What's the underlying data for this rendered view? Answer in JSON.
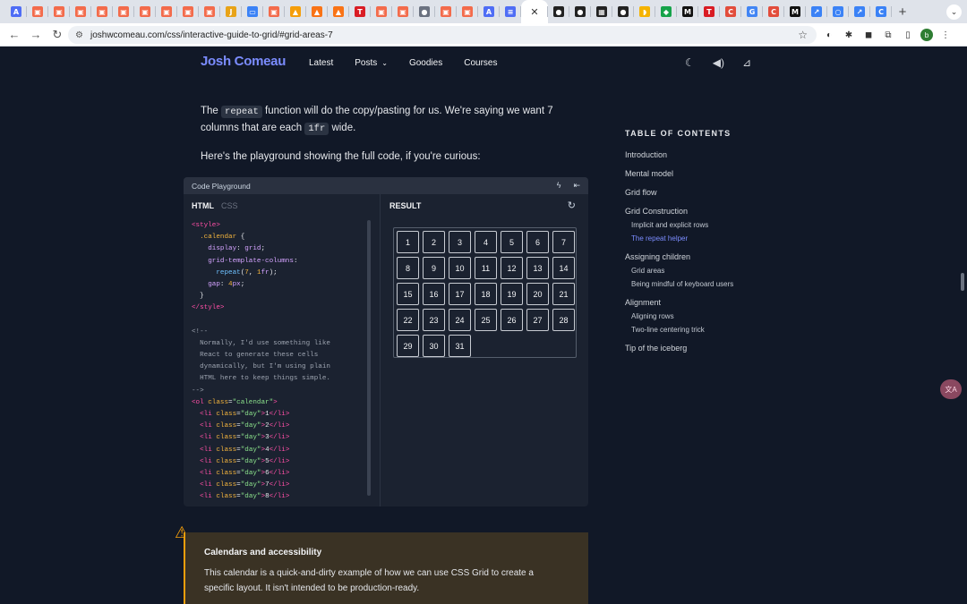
{
  "browser": {
    "tab_favicons": [
      {
        "icon": "translate-icon",
        "glyph": "A",
        "color": "#4f6df5"
      },
      {
        "icon": "grid-icon",
        "glyph": "▣",
        "color": "#f36b4b"
      },
      {
        "icon": "grid-icon",
        "glyph": "▣",
        "color": "#f36b4b"
      },
      {
        "icon": "grid-icon",
        "glyph": "▣",
        "color": "#f36b4b"
      },
      {
        "icon": "grid-icon",
        "glyph": "▣",
        "color": "#f36b4b"
      },
      {
        "icon": "grid-icon",
        "glyph": "▣",
        "color": "#f36b4b"
      },
      {
        "icon": "grid-icon",
        "glyph": "▣",
        "color": "#f36b4b"
      },
      {
        "icon": "grid-icon",
        "glyph": "▣",
        "color": "#f36b4b"
      },
      {
        "icon": "grid-icon",
        "glyph": "▣",
        "color": "#f36b4b"
      },
      {
        "icon": "grid-icon",
        "glyph": "▣",
        "color": "#f36b4b"
      },
      {
        "icon": "js-icon",
        "glyph": "J",
        "color": "#e8a317"
      },
      {
        "icon": "monitor-icon",
        "glyph": "▭",
        "color": "#3b82f6"
      },
      {
        "icon": "grid-icon",
        "glyph": "▣",
        "color": "#f36b4b"
      },
      {
        "icon": "fire-icon",
        "glyph": "▲",
        "color": "#f59e0b"
      },
      {
        "icon": "flame-icon",
        "glyph": "▲",
        "color": "#f97316"
      },
      {
        "icon": "flame-icon",
        "glyph": "▲",
        "color": "#f97316"
      },
      {
        "icon": "tesla-icon",
        "glyph": "T",
        "color": "#d91c24"
      },
      {
        "icon": "grid-icon",
        "glyph": "▣",
        "color": "#f36b4b"
      },
      {
        "icon": "grid-icon",
        "glyph": "▣",
        "color": "#f36b4b"
      },
      {
        "icon": "globe-icon",
        "glyph": "●",
        "color": "#6b7280"
      },
      {
        "icon": "grid-icon",
        "glyph": "▣",
        "color": "#f36b4b"
      },
      {
        "icon": "grid-icon",
        "glyph": "▣",
        "color": "#f36b4b"
      },
      {
        "icon": "translate-icon",
        "glyph": "A",
        "color": "#4f6df5"
      },
      {
        "icon": "document-icon",
        "glyph": "≡",
        "color": "#4f6df5"
      }
    ],
    "tab_favicons_after": [
      {
        "icon": "github-icon",
        "glyph": "●",
        "color": "#222222"
      },
      {
        "icon": "github-icon",
        "glyph": "●",
        "color": "#222222"
      },
      {
        "icon": "qr-icon",
        "glyph": "▦",
        "color": "#222222"
      },
      {
        "icon": "github-icon",
        "glyph": "●",
        "color": "#222222"
      },
      {
        "icon": "banana-icon",
        "glyph": "◗",
        "color": "#f5b301"
      },
      {
        "icon": "shield-icon",
        "glyph": "◆",
        "color": "#16a34a"
      },
      {
        "icon": "notion-icon",
        "glyph": "M",
        "color": "#111111"
      },
      {
        "icon": "tesla-icon",
        "glyph": "T",
        "color": "#d91c24"
      },
      {
        "icon": "copilot-icon",
        "glyph": "C",
        "color": "#e24c3b"
      },
      {
        "icon": "google-icon",
        "glyph": "G",
        "color": "#4285f4"
      },
      {
        "icon": "copilot-icon",
        "glyph": "C",
        "color": "#e24c3b"
      },
      {
        "icon": "notion-icon",
        "glyph": "M",
        "color": "#111111"
      },
      {
        "icon": "link-icon",
        "glyph": "↗",
        "color": "#3b82f6"
      },
      {
        "icon": "circle-icon",
        "glyph": "○",
        "color": "#3b82f6"
      },
      {
        "icon": "link-icon",
        "glyph": "↗",
        "color": "#3b82f6"
      },
      {
        "icon": "chrome-icon",
        "glyph": "C",
        "color": "#3b82f6"
      }
    ],
    "url": "joshwcomeau.com/css/interactive-guide-to-grid/#grid-areas-7",
    "profile_initial": "b"
  },
  "site": {
    "logo": "Josh Comeau",
    "nav": [
      {
        "label": "Latest"
      },
      {
        "label": "Posts"
      },
      {
        "label": "Goodies"
      },
      {
        "label": "Courses"
      }
    ]
  },
  "article": {
    "para1_before": "The ",
    "para1_code1": "repeat",
    "para1_mid": " function will do the copy/pasting for us. We're saying we want 7 columns that are each ",
    "para1_code2": "1fr",
    "para1_after": " wide.",
    "para2": "Here's the playground showing the full code, if you're curious:"
  },
  "playground": {
    "title": "Code Playground",
    "tabs": [
      {
        "label": "HTML"
      },
      {
        "label": "CSS"
      }
    ],
    "result_label": "RESULT",
    "code_lines": [
      [
        [
          "c-tag",
          "<style>"
        ]
      ],
      [
        [
          "c-sel",
          "  .calendar"
        ],
        [
          "c-pl",
          " {"
        ]
      ],
      [
        [
          "c-prop",
          "    display"
        ],
        [
          "c-pl",
          ": "
        ],
        [
          "c-prop",
          "grid"
        ],
        [
          "c-pl",
          ";"
        ]
      ],
      [
        [
          "c-prop",
          "    grid-template-columns"
        ],
        [
          "c-pl",
          ":"
        ]
      ],
      [
        [
          "c-fn",
          "      repeat"
        ],
        [
          "c-pl",
          "("
        ],
        [
          "c-num",
          "7"
        ],
        [
          "c-pl",
          ", "
        ],
        [
          "c-num",
          "1"
        ],
        [
          "c-prop",
          "fr"
        ],
        [
          "c-pl",
          ");"
        ]
      ],
      [
        [
          "c-prop",
          "    gap"
        ],
        [
          "c-pl",
          ": "
        ],
        [
          "c-num",
          "4"
        ],
        [
          "c-prop",
          "px"
        ],
        [
          "c-pl",
          ";"
        ]
      ],
      [
        [
          "c-pl",
          "  }"
        ]
      ],
      [
        [
          "c-tag",
          "</style>"
        ]
      ],
      [
        [
          "c-pl",
          ""
        ]
      ],
      [
        [
          "c-cm",
          "<!--"
        ]
      ],
      [
        [
          "c-cm",
          "  Normally, I'd use something like"
        ]
      ],
      [
        [
          "c-cm",
          "  React to generate these cells"
        ]
      ],
      [
        [
          "c-cm",
          "  dynamically, but I'm using plain"
        ]
      ],
      [
        [
          "c-cm",
          "  HTML here to keep things simple."
        ]
      ],
      [
        [
          "c-cm",
          "-->"
        ]
      ],
      [
        [
          "c-tag",
          "<ol"
        ],
        [
          "c-att",
          " class"
        ],
        [
          "c-pl",
          "="
        ],
        [
          "c-str",
          "\"calendar\""
        ],
        [
          "c-tag",
          ">"
        ]
      ],
      [
        [
          "c-tag",
          "  <li"
        ],
        [
          "c-att",
          " class"
        ],
        [
          "c-pl",
          "="
        ],
        [
          "c-str",
          "\"day\""
        ],
        [
          "c-tag",
          ">"
        ],
        [
          "c-pl",
          "1"
        ],
        [
          "c-tag",
          "</li>"
        ]
      ],
      [
        [
          "c-tag",
          "  <li"
        ],
        [
          "c-att",
          " class"
        ],
        [
          "c-pl",
          "="
        ],
        [
          "c-str",
          "\"day\""
        ],
        [
          "c-tag",
          ">"
        ],
        [
          "c-pl",
          "2"
        ],
        [
          "c-tag",
          "</li>"
        ]
      ],
      [
        [
          "c-tag",
          "  <li"
        ],
        [
          "c-att",
          " class"
        ],
        [
          "c-pl",
          "="
        ],
        [
          "c-str",
          "\"day\""
        ],
        [
          "c-tag",
          ">"
        ],
        [
          "c-pl",
          "3"
        ],
        [
          "c-tag",
          "</li>"
        ]
      ],
      [
        [
          "c-tag",
          "  <li"
        ],
        [
          "c-att",
          " class"
        ],
        [
          "c-pl",
          "="
        ],
        [
          "c-str",
          "\"day\""
        ],
        [
          "c-tag",
          ">"
        ],
        [
          "c-pl",
          "4"
        ],
        [
          "c-tag",
          "</li>"
        ]
      ],
      [
        [
          "c-tag",
          "  <li"
        ],
        [
          "c-att",
          " class"
        ],
        [
          "c-pl",
          "="
        ],
        [
          "c-str",
          "\"day\""
        ],
        [
          "c-tag",
          ">"
        ],
        [
          "c-pl",
          "5"
        ],
        [
          "c-tag",
          "</li>"
        ]
      ],
      [
        [
          "c-tag",
          "  <li"
        ],
        [
          "c-att",
          " class"
        ],
        [
          "c-pl",
          "="
        ],
        [
          "c-str",
          "\"day\""
        ],
        [
          "c-tag",
          ">"
        ],
        [
          "c-pl",
          "6"
        ],
        [
          "c-tag",
          "</li>"
        ]
      ],
      [
        [
          "c-tag",
          "  <li"
        ],
        [
          "c-att",
          " class"
        ],
        [
          "c-pl",
          "="
        ],
        [
          "c-str",
          "\"day\""
        ],
        [
          "c-tag",
          ">"
        ],
        [
          "c-pl",
          "7"
        ],
        [
          "c-tag",
          "</li>"
        ]
      ],
      [
        [
          "c-tag",
          "  <li"
        ],
        [
          "c-att",
          " class"
        ],
        [
          "c-pl",
          "="
        ],
        [
          "c-str",
          "\"day\""
        ],
        [
          "c-tag",
          ">"
        ],
        [
          "c-pl",
          "8"
        ],
        [
          "c-tag",
          "</li>"
        ]
      ]
    ],
    "days": [
      "1",
      "2",
      "3",
      "4",
      "5",
      "6",
      "7",
      "8",
      "9",
      "10",
      "11",
      "12",
      "13",
      "14",
      "15",
      "16",
      "17",
      "18",
      "19",
      "20",
      "21",
      "22",
      "23",
      "24",
      "25",
      "26",
      "27",
      "28",
      "29",
      "30",
      "31"
    ]
  },
  "toc": {
    "title": "TABLE OF CONTENTS",
    "items": [
      {
        "label": "Introduction",
        "level": 1,
        "active": false
      },
      {
        "label": "Mental model",
        "level": 1,
        "active": false
      },
      {
        "label": "Grid flow",
        "level": 1,
        "active": false
      },
      {
        "label": "Grid Construction",
        "level": 1,
        "active": false
      },
      {
        "label": "Implicit and explicit rows",
        "level": 2,
        "active": false
      },
      {
        "label": "The repeat helper",
        "level": 2,
        "active": true
      },
      {
        "label": "Assigning children",
        "level": 1,
        "active": false
      },
      {
        "label": "Grid areas",
        "level": 2,
        "active": false
      },
      {
        "label": "Being mindful of keyboard users",
        "level": 2,
        "active": false
      },
      {
        "label": "Alignment",
        "level": 1,
        "active": false
      },
      {
        "label": "Aligning rows",
        "level": 2,
        "active": false
      },
      {
        "label": "Two-line centering trick",
        "level": 2,
        "active": false
      },
      {
        "label": "Tip of the iceberg",
        "level": 1,
        "active": false
      }
    ]
  },
  "callout": {
    "title": "Calendars and accessibility",
    "text": "This calendar is a quick-and-dirty example of how we can use CSS Grid to create a specific layout. It isn't intended to be production-ready."
  }
}
